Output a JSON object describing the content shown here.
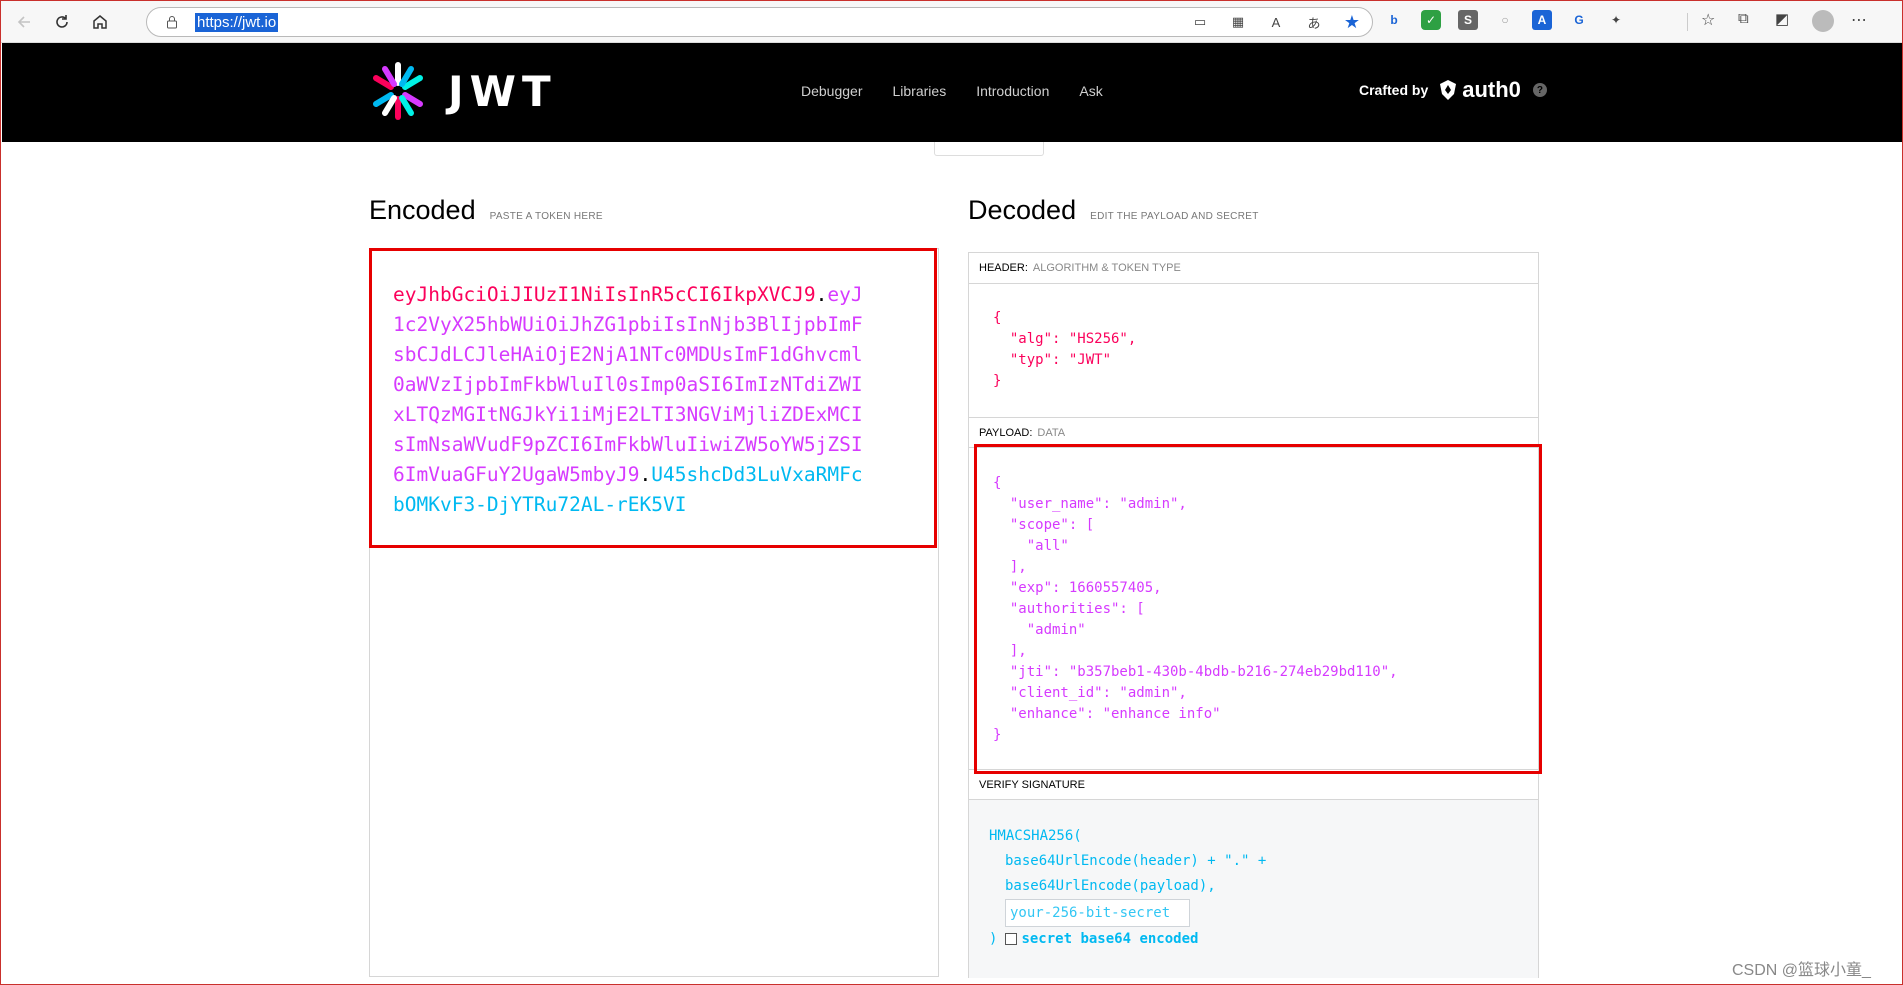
{
  "browser": {
    "url": "https://jwt.io",
    "extensions": [
      "b",
      "✓",
      "S",
      "○",
      "A",
      "G"
    ]
  },
  "site": {
    "logo_text": "JWT",
    "nav": [
      "Debugger",
      "Libraries",
      "Introduction",
      "Ask"
    ],
    "crafted_by": "Crafted by",
    "brand": "auth0",
    "help": "?"
  },
  "encoded": {
    "title": "Encoded",
    "subtitle": "PASTE A TOKEN HERE",
    "header_part": "eyJhbGciOiJIUzI1NiIsInR5cCI6IkpXVCJ9",
    "payload_part": "eyJ1c2VyX25hbWUiOiJhZG1pbiIsInNjb3BlIjpbImFsbCJdLCJleHAiOjE2NjA1NTc0MDUsImF1dGhvcml0aWVzIjpbImFkbWluIl0sImp0aSI6ImIzNTdiZWIxLTQzMGItNGJkYi1iMjE2LTI3NGViMjliZDExMCIsImNsaWVudF9pZCI6ImFkbWluIiwiZW5oYW5jZSI6ImVuaGFuY2UgaW5mbyJ9",
    "signature_part": "U45shcDd3LuVxaRMFcbOMKvF3-DjYTRu72AL-rEK5VI",
    "dot": "."
  },
  "decoded": {
    "title": "Decoded",
    "subtitle": "EDIT THE PAYLOAD AND SECRET",
    "header_label": "HEADER:",
    "header_sub": "ALGORITHM & TOKEN TYPE",
    "header_json": "{\n  \"alg\": \"HS256\",\n  \"typ\": \"JWT\"\n}",
    "payload_label": "PAYLOAD:",
    "payload_sub": "DATA",
    "payload_json": "{\n  \"user_name\": \"admin\",\n  \"scope\": [\n    \"all\"\n  ],\n  \"exp\": 1660557405,\n  \"authorities\": [\n    \"admin\"\n  ],\n  \"jti\": \"b357beb1-430b-4bdb-b216-274eb29bd110\",\n  \"client_id\": \"admin\",\n  \"enhance\": \"enhance info\"\n}",
    "verify_label": "VERIFY SIGNATURE",
    "verify_fn": "HMACSHA256(",
    "verify_line1": "base64UrlEncode(header) + \".\" +",
    "verify_line2": "base64UrlEncode(payload),",
    "secret_placeholder": "your-256-bit-secret",
    "close_paren": ")",
    "b64_label": "secret base64 encoded"
  },
  "watermark": "CSDN @篮球小童_"
}
